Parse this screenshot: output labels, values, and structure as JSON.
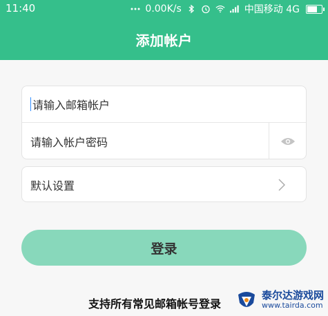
{
  "status_bar": {
    "time": "11:40",
    "speed": "0.00K/s",
    "carrier": "中国移动 4G"
  },
  "header": {
    "title": "添加帐户"
  },
  "login_form": {
    "email_placeholder": "请输入邮箱帐户",
    "password_placeholder": "请输入帐户密码"
  },
  "settings": {
    "label": "默认设置"
  },
  "login_button": {
    "label": "登录"
  },
  "footer": {
    "support_text": "支持所有常见邮箱帐号登录"
  },
  "watermark": {
    "name": "泰尔达游戏网",
    "url": "www.tairda.com"
  },
  "colors": {
    "accent": "#35bf8b",
    "button": "#88d8bb",
    "background": "#f7f7f7"
  }
}
